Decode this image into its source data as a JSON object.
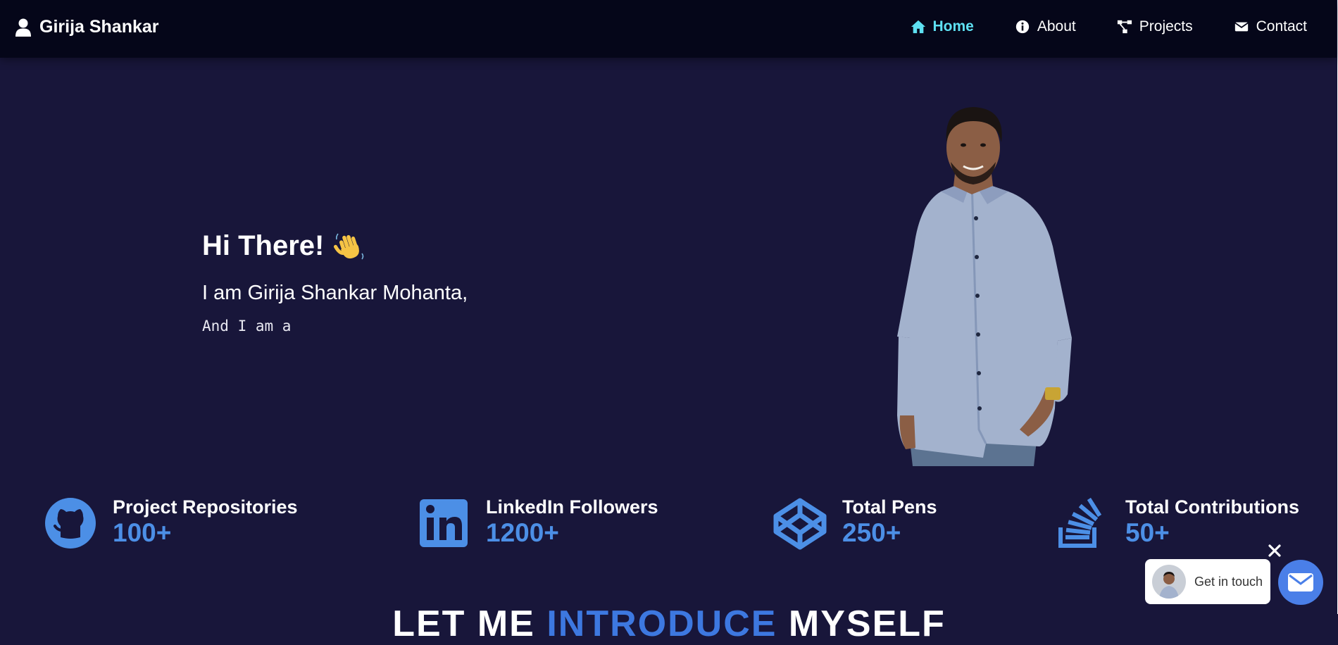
{
  "nav": {
    "brand": "Girija Shankar",
    "links": [
      {
        "label": "Home",
        "icon": "home-icon",
        "active": true
      },
      {
        "label": "About",
        "icon": "info-icon"
      },
      {
        "label": "Projects",
        "icon": "project-diagram-icon"
      },
      {
        "label": "Contact",
        "icon": "envelope-icon"
      }
    ]
  },
  "hero": {
    "greeting": "Hi There!",
    "name_line": "I am Girija Shankar Mohanta,",
    "role_line": "And I am a"
  },
  "stats": [
    {
      "label": "Project Repositories",
      "value": "100+",
      "icon": "github-icon"
    },
    {
      "label": "LinkedIn Followers",
      "value": "1200+",
      "icon": "linkedin-icon"
    },
    {
      "label": "Total Pens",
      "value": "250+",
      "icon": "codepen-icon"
    },
    {
      "label": "Total Contributions",
      "value": "50+",
      "icon": "stackoverflow-icon"
    }
  ],
  "intro": {
    "part1": "LET ME",
    "accent": "INTRODUCE",
    "part2": "MYSELF"
  },
  "widget": {
    "label": "Get in touch"
  },
  "colors": {
    "background": "#18163a",
    "navbar": "#050619",
    "active_link": "#5ee0f2",
    "accent_blue": "#4c8fe6"
  }
}
